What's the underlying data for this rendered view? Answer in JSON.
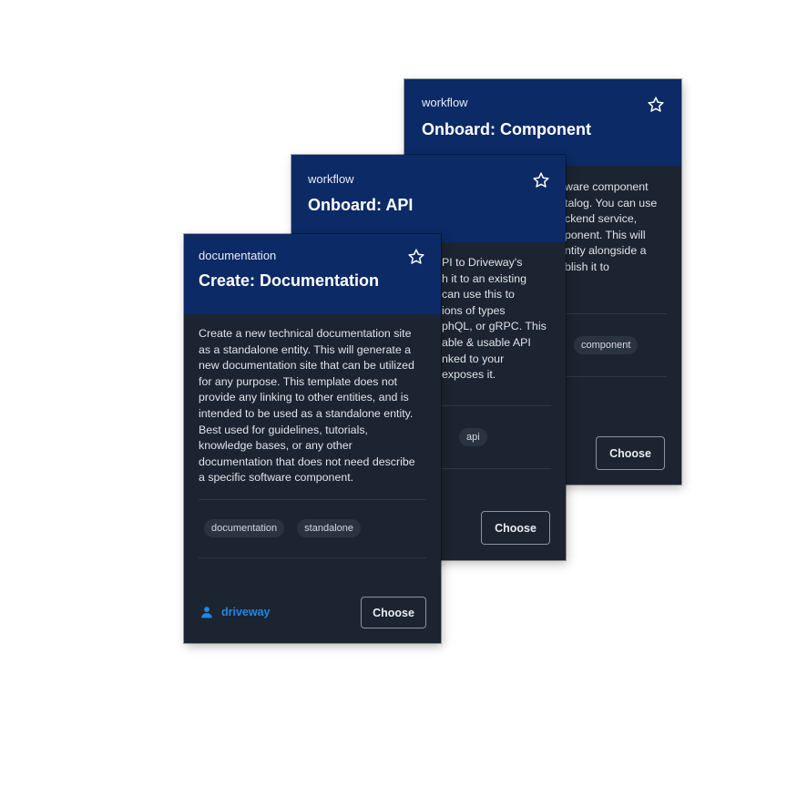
{
  "colors": {
    "card_background": "#1b2430",
    "header_background": "#0b2a66",
    "tag_background": "#2a3340",
    "link_accent": "#1e88e5",
    "divider": "#2d3744"
  },
  "cards": [
    {
      "type": "workflow",
      "title": "Onboard: Component",
      "description": "Onboard a software component to the catalog. You can use this to onboard a backend service, library, or other component. This will register the entity alongside a project and publish it to Driveway.",
      "visible_description_lines": [
        "ware component",
        "talog. You can use",
        "ckend service,",
        "ponent. This will",
        "ntity alongside a",
        "blish it to"
      ],
      "tags": [
        "component"
      ],
      "favorite_icon": "star-outline-icon",
      "choose_label": "Choose"
    },
    {
      "type": "workflow",
      "title": "Onboard: API",
      "visible_description_lines": [
        "PI to Driveway's",
        "h it to an existing",
        "can use this to",
        "ions of types",
        "phQL, or gRPC. This",
        "able & usable API",
        "nked to your",
        "exposes it."
      ],
      "tags": [
        "api"
      ],
      "favorite_icon": "star-outline-icon",
      "choose_label": "Choose"
    },
    {
      "type": "documentation",
      "title": "Create: Documentation",
      "description_lines": [
        "Create a new technical documentation site",
        "as a standalone entity. This will generate a",
        "new documentation site that can be utilized",
        "for any purpose. This template does not",
        "provide any linking to other entities, and is",
        "intended to be used as a standalone entity.",
        "Best used for guidelines, tutorials,",
        "knowledge bases, or any other",
        "documentation that does not need describe",
        "a specific software component."
      ],
      "tags": [
        "documentation",
        "standalone"
      ],
      "favorite_icon": "star-outline-icon",
      "owner": {
        "icon": "user-icon",
        "name": "driveway"
      },
      "choose_label": "Choose"
    }
  ]
}
